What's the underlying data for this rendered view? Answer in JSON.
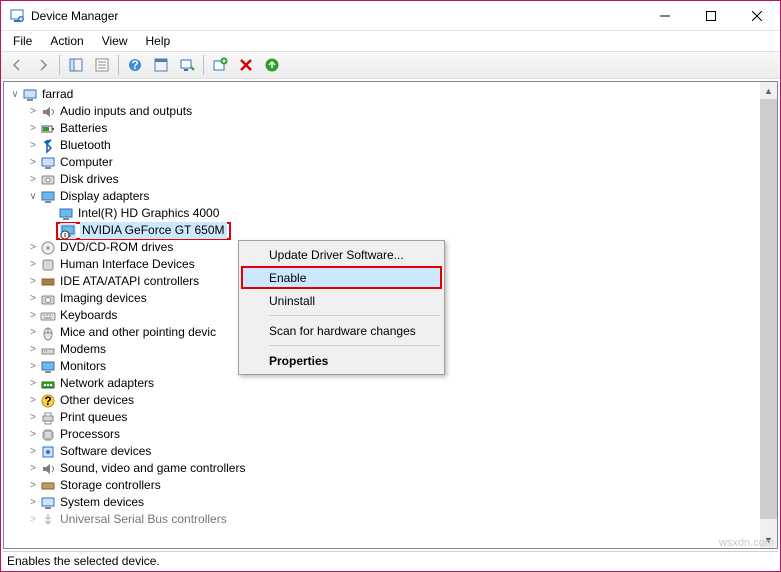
{
  "window": {
    "title": "Device Manager"
  },
  "menu": {
    "file": "File",
    "action": "Action",
    "view": "View",
    "help": "Help"
  },
  "tree": {
    "root": "farrad",
    "items": [
      "Audio inputs and outputs",
      "Batteries",
      "Bluetooth",
      "Computer",
      "Disk drives"
    ],
    "display_adapters": {
      "label": "Display adapters",
      "child1": "Intel(R) HD Graphics 4000",
      "child2": "NVIDIA GeForce GT 650M"
    },
    "rest": [
      "DVD/CD-ROM drives",
      "Human Interface Devices",
      "IDE ATA/ATAPI controllers",
      "Imaging devices",
      "Keyboards",
      "Mice and other pointing devic",
      "Modems",
      "Monitors",
      "Network adapters",
      "Other devices",
      "Print queues",
      "Processors",
      "Software devices",
      "Sound, video and game controllers",
      "Storage controllers",
      "System devices",
      "Universal Serial Bus controllers"
    ]
  },
  "context_menu": {
    "update": "Update Driver Software...",
    "enable": "Enable",
    "uninstall": "Uninstall",
    "scan": "Scan for hardware changes",
    "properties": "Properties"
  },
  "status": "Enables the selected device.",
  "watermark": "wsxdn.com"
}
